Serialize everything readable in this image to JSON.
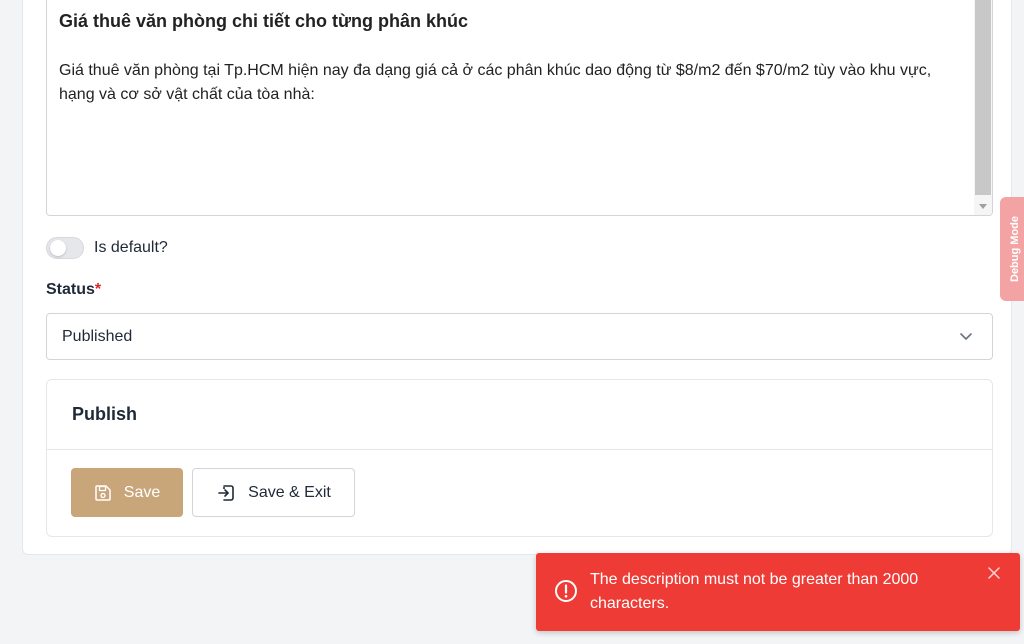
{
  "editor": {
    "heading": "Giá thuê văn phòng chi tiết cho từng phân khúc",
    "paragraph": "Giá thuê văn phòng tại Tp.HCM hiện nay đa dạng giá cả ở các phân khúc dao động từ $8/m2 đến $70/m2 tùy vào khu vực, hạng và cơ sở vật chất của tòa nhà:"
  },
  "is_default": {
    "label": "Is default?",
    "checked": false
  },
  "status": {
    "label": "Status",
    "required_mark": "*",
    "selected": "Published"
  },
  "publish": {
    "title": "Publish",
    "save_label": "Save",
    "save_exit_label": "Save & Exit"
  },
  "debug": {
    "label": "Debug Mode"
  },
  "toast": {
    "message": "The description must not be greater than 2000 characters."
  },
  "colors": {
    "accent": "#c9a57a",
    "error": "#ef3b36",
    "debug_tab": "#f3a3a3"
  },
  "icons": {
    "save": "floppy-disk-icon",
    "save_exit": "exit-icon",
    "select": "chevron-down-icon",
    "toast": "error-circle-icon",
    "close": "close-icon"
  }
}
